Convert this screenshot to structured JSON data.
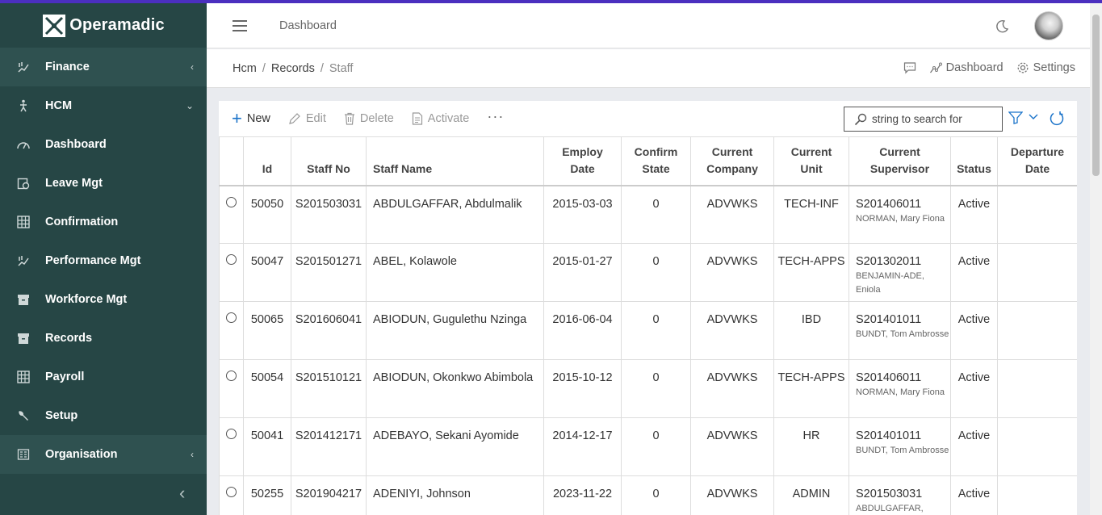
{
  "app": {
    "name": "Operamadic"
  },
  "sidebar": {
    "items": [
      {
        "label": "Finance",
        "icon": "chart-hand-icon",
        "chevron": "‹"
      },
      {
        "label": "HCM",
        "icon": "person-walk-icon",
        "chevron": "›"
      },
      {
        "label": "Dashboard",
        "icon": "gauge-icon"
      },
      {
        "label": "Leave Mgt",
        "icon": "calendar-clock-icon"
      },
      {
        "label": "Confirmation",
        "icon": "grid-icon"
      },
      {
        "label": "Performance Mgt",
        "icon": "chart-hand-icon"
      },
      {
        "label": "Workforce Mgt",
        "icon": "archive-icon"
      },
      {
        "label": "Records",
        "icon": "archive-icon"
      },
      {
        "label": "Payroll",
        "icon": "calculator-icon"
      },
      {
        "label": "Setup",
        "icon": "wrench-icon"
      },
      {
        "label": "Organisation",
        "icon": "building-icon",
        "chevron": "‹"
      }
    ]
  },
  "header": {
    "title": "Dashboard"
  },
  "breadcrumb": {
    "items": [
      "Hcm",
      "Records",
      "Staff"
    ]
  },
  "crumb_actions": {
    "dashboard": "Dashboard",
    "settings": "Settings"
  },
  "toolbar": {
    "new": "New",
    "edit": "Edit",
    "delete": "Delete",
    "activate": "Activate",
    "more": "···",
    "search_placeholder": "string to search for"
  },
  "table": {
    "headers": {
      "id": "Id",
      "staff_no": "Staff No",
      "staff_name": "Staff Name",
      "employ_date_1": "Employ",
      "employ_date_2": "Date",
      "confirm_1": "Confirm",
      "confirm_2": "State",
      "company_1": "Current",
      "company_2": "Company",
      "unit_1": "Current",
      "unit_2": "Unit",
      "supervisor_1": "Current",
      "supervisor_2": "Supervisor",
      "status": "Status",
      "departure_1": "Departure",
      "departure_2": "Date"
    },
    "rows": [
      {
        "id": "50050",
        "staff_no": "S201503031",
        "name": "ABDULGAFFAR, Abdulmalik",
        "employ_date": "2015-03-03",
        "confirm": "0",
        "company": "ADVWKS",
        "unit": "TECH-INF",
        "sup_id": "S201406011",
        "sup_name": "NORMAN, Mary Fiona",
        "status": "Active",
        "departure": ""
      },
      {
        "id": "50047",
        "staff_no": "S201501271",
        "name": "ABEL, Kolawole",
        "employ_date": "2015-01-27",
        "confirm": "0",
        "company": "ADVWKS",
        "unit": "TECH-APPS",
        "sup_id": "S201302011",
        "sup_name": "BENJAMIN-ADE, Eniola",
        "status": "Active",
        "departure": ""
      },
      {
        "id": "50065",
        "staff_no": "S201606041",
        "name": "ABIODUN, Gugulethu Nzinga",
        "employ_date": "2016-06-04",
        "confirm": "0",
        "company": "ADVWKS",
        "unit": "IBD",
        "sup_id": "S201401011",
        "sup_name": "BUNDT, Tom Ambrosse",
        "status": "Active",
        "departure": ""
      },
      {
        "id": "50054",
        "staff_no": "S201510121",
        "name": "ABIODUN, Okonkwo Abimbola",
        "employ_date": "2015-10-12",
        "confirm": "0",
        "company": "ADVWKS",
        "unit": "TECH-APPS",
        "sup_id": "S201406011",
        "sup_name": "NORMAN, Mary Fiona",
        "status": "Active",
        "departure": ""
      },
      {
        "id": "50041",
        "staff_no": "S201412171",
        "name": "ADEBAYO, Sekani Ayomide",
        "employ_date": "2014-12-17",
        "confirm": "0",
        "company": "ADVWKS",
        "unit": "HR",
        "sup_id": "S201401011",
        "sup_name": "BUNDT, Tom Ambrosse",
        "status": "Active",
        "departure": ""
      },
      {
        "id": "50255",
        "staff_no": "S201904217",
        "name": "ADENIYI, Johnson",
        "employ_date": "2023-11-22",
        "confirm": "0",
        "company": "ADVWKS",
        "unit": "ADMIN",
        "sup_id": "S201503031",
        "sup_name": "ABDULGAFFAR,",
        "status": "Active",
        "departure": ""
      }
    ]
  },
  "colors": {
    "sidebar_bg": "#264645",
    "accent": "#1a73c9",
    "top_accent": "#4b2fbf"
  }
}
